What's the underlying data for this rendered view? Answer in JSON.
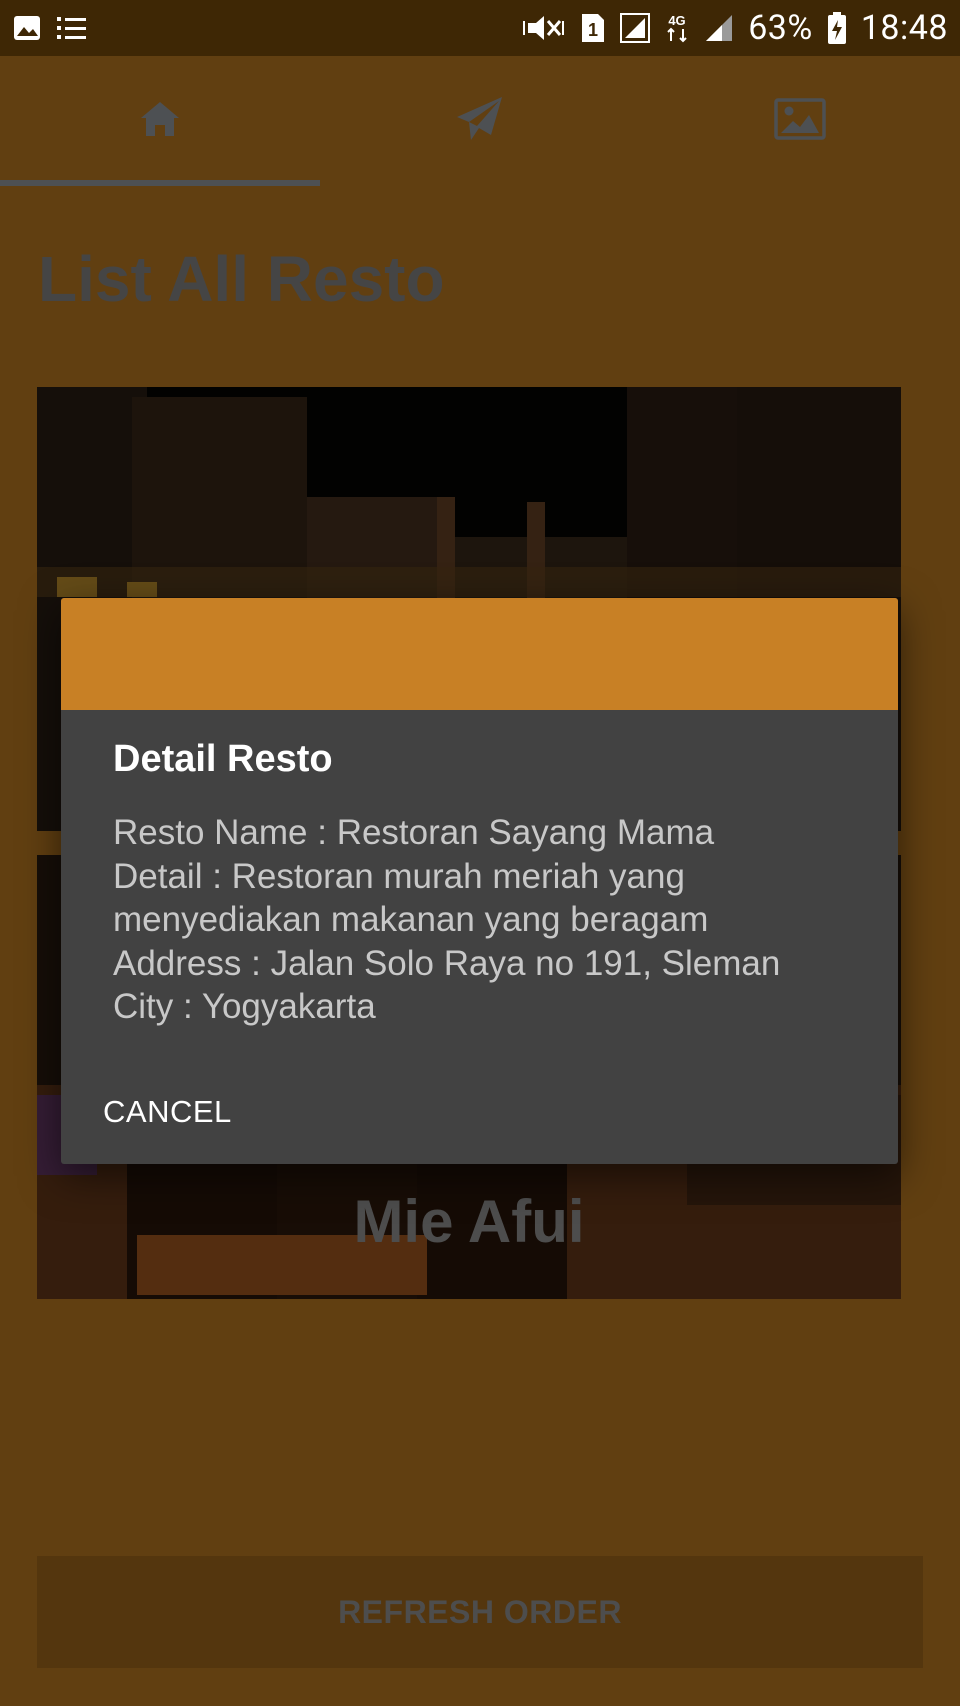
{
  "status_bar": {
    "battery_percent": "63%",
    "time": "18:48",
    "sim_slot": "1",
    "network": "4G"
  },
  "tabs": [
    {
      "icon": "home-icon",
      "selected": true
    },
    {
      "icon": "send-icon",
      "selected": false
    },
    {
      "icon": "image-icon",
      "selected": false
    }
  ],
  "main": {
    "title": "List All Resto",
    "cards": [
      {
        "name": ""
      },
      {
        "name": "Mie Afui"
      }
    ],
    "refresh_label": "REFRESH ORDER"
  },
  "dialog": {
    "title": "Detail Resto",
    "lines": [
      "Resto Name : Restoran Sayang Mama",
      "Detail : Restoran murah meriah yang",
      "menyediakan makanan yang beragam",
      "Address : Jalan Solo Raya no 191, Sleman",
      "City : Yogyakarta"
    ],
    "cancel_label": "CANCEL"
  },
  "colors": {
    "accent": "#c88025",
    "dialog_bg": "#424242",
    "status_bar": "#3e2705"
  }
}
